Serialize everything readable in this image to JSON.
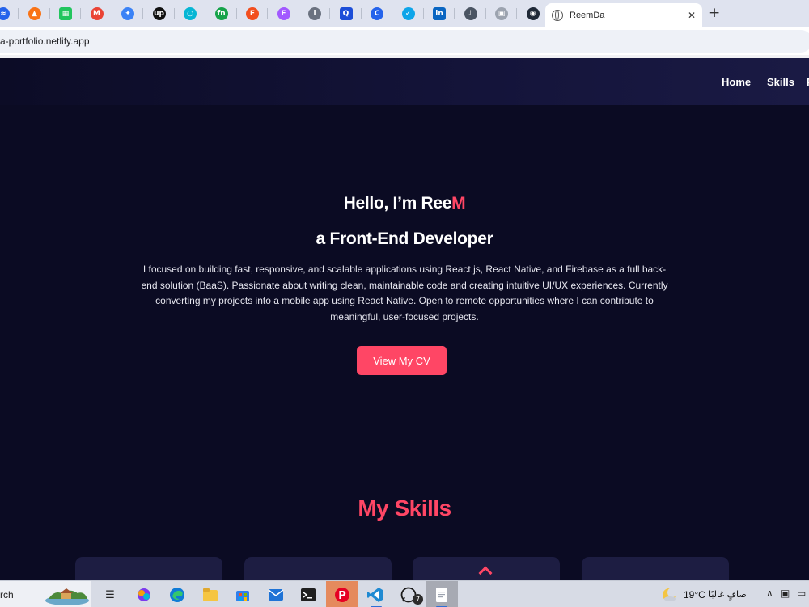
{
  "browser": {
    "pinned_tabs": [
      {
        "icon": "wave-icon",
        "glyph": "≈",
        "color": "#2563eb"
      },
      {
        "icon": "fire-icon",
        "glyph": "▲",
        "color": "#f97316"
      },
      {
        "icon": "grid-icon",
        "glyph": "▦",
        "color": "#22c55e"
      },
      {
        "icon": "gmail-icon",
        "glyph": "M",
        "color": "#ea4335"
      },
      {
        "icon": "sparkle-icon",
        "glyph": "✦",
        "color": "#3b82f6"
      },
      {
        "icon": "upwork-icon",
        "glyph": "up",
        "color": "#111111"
      },
      {
        "icon": "ring-icon",
        "glyph": "○",
        "color": "#06b6d4"
      },
      {
        "icon": "fn-icon",
        "glyph": "fn",
        "color": "#16a34a"
      },
      {
        "icon": "figma-icon",
        "glyph": "F",
        "color": "#f24e1e"
      },
      {
        "icon": "figma-icon-2",
        "glyph": "F",
        "color": "#a259ff"
      },
      {
        "icon": "info-icon",
        "glyph": "i",
        "color": "#6b7280"
      },
      {
        "icon": "quill-icon",
        "glyph": "Q",
        "color": "#1d4ed8"
      },
      {
        "icon": "c-icon",
        "glyph": "C",
        "color": "#2563eb"
      },
      {
        "icon": "bird-icon",
        "glyph": "✓",
        "color": "#0ea5e9"
      },
      {
        "icon": "linkedin-icon",
        "glyph": "in",
        "color": "#0a66c2"
      },
      {
        "icon": "speaker-icon",
        "glyph": "♪",
        "color": "#4b5563"
      },
      {
        "icon": "picture-icon",
        "glyph": "▣",
        "color": "#9ca3af"
      },
      {
        "icon": "target-icon",
        "glyph": "◉",
        "color": "#1f2937"
      }
    ],
    "active_tab_title": "ReemDa",
    "url": "a-portfolio.netlify.app"
  },
  "site": {
    "nav": {
      "home": "Home",
      "skills": "Skills",
      "more": "P"
    },
    "hero": {
      "greeting_prefix": "Hello, I’m Ree",
      "greeting_accent": "M",
      "role": "a Front-End Developer",
      "description": "I focused on building fast, responsive, and scalable applications using React.js, React Native, and Firebase as a full back-end solution (BaaS). Passionate about writing clean, maintainable code and creating intuitive UI/UX experiences. Currently converting my projects into a mobile app using React Native. Open to remote opportunities where I can contribute to meaningful, user-focused projects.",
      "cta": "View My CV"
    },
    "skills_heading": "My Skills",
    "accent_color": "#ff4665",
    "background_color": "#0b0b23"
  },
  "taskbar": {
    "search_text": "rch",
    "badge_count": "7",
    "temperature": "19°C",
    "weather": "صافٍ غالبًا",
    "apps": [
      "task-view-icon",
      "copilot-icon",
      "edge-icon",
      "file-explorer-icon",
      "store-icon",
      "mail-icon",
      "terminal-icon",
      "pinterest-icon",
      "vscode-icon",
      "whatsapp-icon",
      "notepad-icon"
    ]
  }
}
